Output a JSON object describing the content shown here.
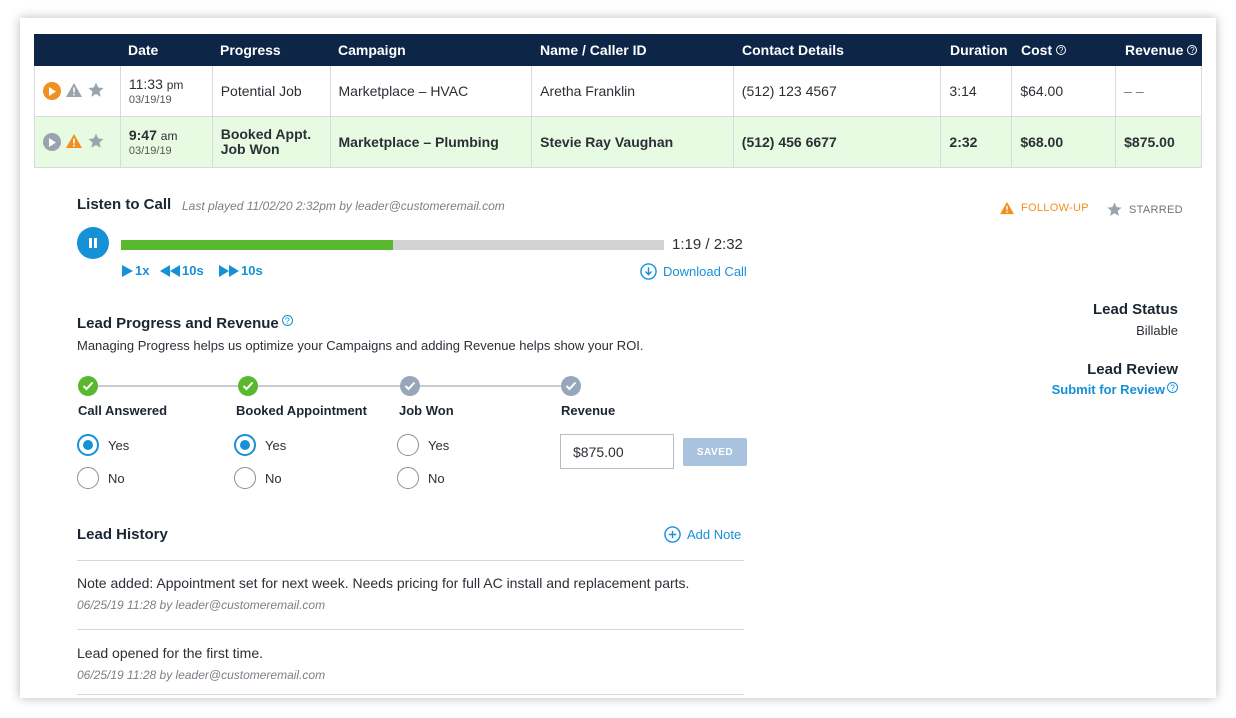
{
  "table": {
    "headers": [
      "",
      "Date",
      "Progress",
      "Campaign",
      "Name / Caller ID",
      "Contact Details",
      "Duration",
      "Cost",
      "Revenue"
    ],
    "rows": [
      {
        "time": "11:33",
        "ampm": "pm",
        "date": "03/19/19",
        "progress_1": "Potential Job",
        "progress_2": "",
        "campaign": "Marketplace – HVAC",
        "name": "Aretha Franklin",
        "contact": "(512) 123 4567",
        "duration": "3:14",
        "cost": "$64.00",
        "revenue": "– –"
      },
      {
        "time": "9:47",
        "ampm": "am",
        "date": "03/19/19",
        "progress_1": "Booked Appt.",
        "progress_2": "Job Won",
        "campaign": "Marketplace – Plumbing",
        "name": "Stevie Ray Vaughan",
        "contact": "(512) 456 6677",
        "duration": "2:32",
        "cost": "$68.00",
        "revenue": "$875.00"
      }
    ]
  },
  "listen": {
    "title": "Listen to Call",
    "last_played": "Last played 11/02/20 2:32pm by leader@customeremail.com",
    "progress": 0.5,
    "time": "1:19 / 2:32",
    "speed": "1x",
    "rewind": "10s",
    "forward": "10s",
    "download": "Download Call"
  },
  "flags": {
    "followup": "FOLLOW-UP",
    "starred": "STARRED"
  },
  "lead_progress": {
    "title": "Lead Progress and Revenue",
    "description": "Managing Progress helps us optimize your Campaigns and adding Revenue helps show your ROI.",
    "steps": [
      {
        "label": "Call Answered",
        "done": true
      },
      {
        "label": "Booked Appointment",
        "done": true
      },
      {
        "label": "Job Won",
        "done": false
      },
      {
        "label": "Revenue",
        "done": false
      }
    ],
    "yes": "Yes",
    "no": "No",
    "revenue_value": "$875.00",
    "saved_label": "SAVED"
  },
  "right_panel": {
    "status_label": "Lead Status",
    "status_value": "Billable",
    "review_label": "Lead Review",
    "review_link": "Submit for Review"
  },
  "history": {
    "title": "Lead History",
    "add_note": "Add Note",
    "entries": [
      {
        "text": "Note added: Appointment set for next week. Needs pricing for full AC install and replacement parts.",
        "meta": "06/25/19 11:28 by leader@customeremail.com"
      },
      {
        "text": "Lead opened for the first time.",
        "meta": "06/25/19 11:28 by leader@customeremail.com"
      }
    ]
  },
  "colors": {
    "header_bg": "#0d2546",
    "accent_blue": "#1691d8",
    "success_green": "#58b92f",
    "warning_orange": "#f0901e",
    "highlight_row": "#e7fbe2"
  }
}
